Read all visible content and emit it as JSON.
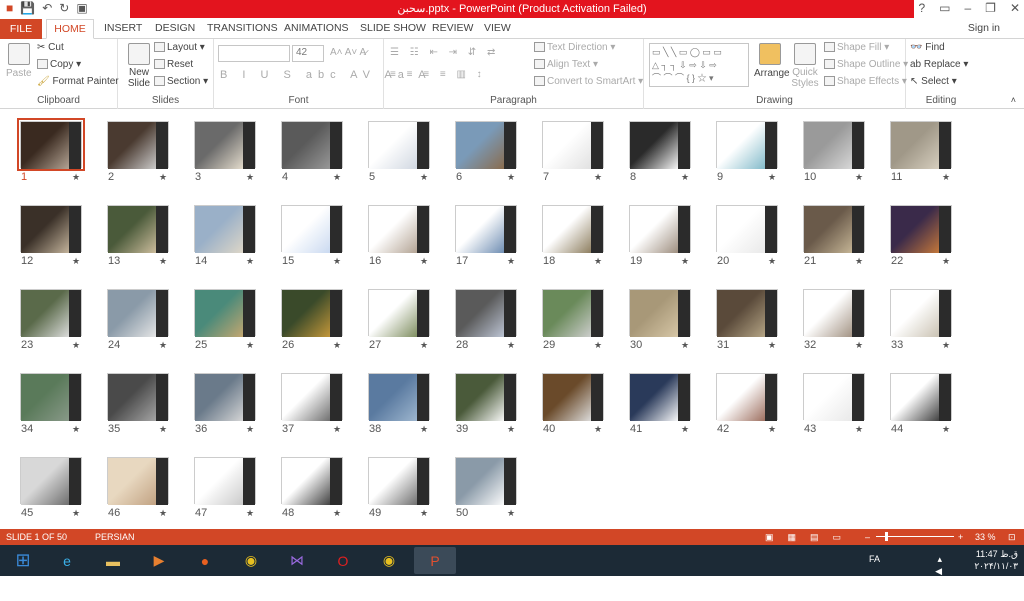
{
  "window": {
    "title": "سحبن.pptx - PowerPoint (Product Activation Failed)"
  },
  "tabs": {
    "file": "FILE",
    "home": "HOME",
    "insert": "INSERT",
    "design": "DESIGN",
    "transitions": "TRANSITIONS",
    "animations": "ANIMATIONS",
    "slideshow": "SLIDE SHOW",
    "review": "REVIEW",
    "view": "VIEW",
    "signin": "Sign in"
  },
  "ribbon": {
    "clipboard": {
      "label": "Clipboard",
      "paste": "Paste",
      "cut": "Cut",
      "copy": "Copy",
      "format_painter": "Format Painter"
    },
    "slides": {
      "label": "Slides",
      "new_slide": "New Slide",
      "layout": "Layout",
      "reset": "Reset",
      "section": "Section"
    },
    "font": {
      "label": "Font",
      "size": "42"
    },
    "paragraph": {
      "label": "Paragraph",
      "text_direction": "Text Direction",
      "align_text": "Align Text",
      "convert_smartart": "Convert to SmartArt"
    },
    "drawing": {
      "label": "Drawing",
      "arrange": "Arrange",
      "quick_styles": "Quick Styles",
      "shape_fill": "Shape Fill",
      "shape_outline": "Shape Outline",
      "shape_effects": "Shape Effects"
    },
    "editing": {
      "label": "Editing",
      "find": "Find",
      "replace": "Replace",
      "select": "Select"
    }
  },
  "slides": [
    {
      "n": "1",
      "colors": [
        "#3a2a20",
        "#b8a898"
      ]
    },
    {
      "n": "2",
      "colors": [
        "#4a3a30",
        "#cfcfcf"
      ]
    },
    {
      "n": "3",
      "colors": [
        "#6a6a6a",
        "#e8e0d0"
      ]
    },
    {
      "n": "4",
      "colors": [
        "#5a5a5a",
        "#9a9a9a"
      ]
    },
    {
      "n": "5",
      "colors": [
        "#ffffff",
        "#cfd6e0"
      ]
    },
    {
      "n": "6",
      "colors": [
        "#7a9ab8",
        "#8a6a4a"
      ]
    },
    {
      "n": "7",
      "colors": [
        "#ffffff",
        "#e0e0e0"
      ]
    },
    {
      "n": "8",
      "colors": [
        "#2a2a2a",
        "#ffffff"
      ]
    },
    {
      "n": "9",
      "colors": [
        "#ffffff",
        "#7fb8c8"
      ]
    },
    {
      "n": "10",
      "colors": [
        "#9a9a9a",
        "#dadada"
      ]
    },
    {
      "n": "11",
      "colors": [
        "#a09888",
        "#d8d0c0"
      ]
    },
    {
      "n": "12",
      "colors": [
        "#3a3028",
        "#c8b8a0"
      ]
    },
    {
      "n": "13",
      "colors": [
        "#4a5a3a",
        "#d0c0a0"
      ]
    },
    {
      "n": "14",
      "colors": [
        "#9ab0c8",
        "#e0d8c8"
      ]
    },
    {
      "n": "15",
      "colors": [
        "#ffffff",
        "#c8d8f0"
      ]
    },
    {
      "n": "16",
      "colors": [
        "#ffffff",
        "#b0a090"
      ]
    },
    {
      "n": "17",
      "colors": [
        "#ffffff",
        "#6a8ab0"
      ]
    },
    {
      "n": "18",
      "colors": [
        "#ffffff",
        "#8a7a5a"
      ]
    },
    {
      "n": "19",
      "colors": [
        "#ffffff",
        "#9a8a7a"
      ]
    },
    {
      "n": "20",
      "colors": [
        "#ffffff",
        "#e8e8e8"
      ]
    },
    {
      "n": "21",
      "colors": [
        "#6a5a4a",
        "#c8b898"
      ]
    },
    {
      "n": "22",
      "colors": [
        "#3a2a4a",
        "#c87a3a"
      ]
    },
    {
      "n": "23",
      "colors": [
        "#5a6a4a",
        "#e0e0e0"
      ]
    },
    {
      "n": "24",
      "colors": [
        "#8a9aa8",
        "#e8e8e8"
      ]
    },
    {
      "n": "25",
      "colors": [
        "#4a8a7a",
        "#c8a870"
      ]
    },
    {
      "n": "26",
      "colors": [
        "#3a4a2a",
        "#c89a3a"
      ]
    },
    {
      "n": "27",
      "colors": [
        "#ffffff",
        "#7a8a5a"
      ]
    },
    {
      "n": "28",
      "colors": [
        "#5a5a5a",
        "#c0c8d8"
      ]
    },
    {
      "n": "29",
      "colors": [
        "#6a8a5a",
        "#d0d0d0"
      ]
    },
    {
      "n": "30",
      "colors": [
        "#a89878",
        "#d8c8a8"
      ]
    },
    {
      "n": "31",
      "colors": [
        "#5a4a3a",
        "#b8a888"
      ]
    },
    {
      "n": "32",
      "colors": [
        "#ffffff",
        "#a09080"
      ]
    },
    {
      "n": "33",
      "colors": [
        "#ffffff",
        "#c8c0b0"
      ]
    },
    {
      "n": "34",
      "colors": [
        "#5a7a5a",
        "#8a9a8a"
      ]
    },
    {
      "n": "35",
      "colors": [
        "#4a4a4a",
        "#a8a8a8"
      ]
    },
    {
      "n": "36",
      "colors": [
        "#6a7a8a",
        "#d8d8d8"
      ]
    },
    {
      "n": "37",
      "colors": [
        "#ffffff",
        "#6a6a6a"
      ]
    },
    {
      "n": "38",
      "colors": [
        "#5a7aa0",
        "#a0b8d0"
      ]
    },
    {
      "n": "39",
      "colors": [
        "#4a5a3a",
        "#ffffff"
      ]
    },
    {
      "n": "40",
      "colors": [
        "#6a4a2a",
        "#e0e0e0"
      ]
    },
    {
      "n": "41",
      "colors": [
        "#2a3a5a",
        "#ffffff"
      ]
    },
    {
      "n": "42",
      "colors": [
        "#ffffff",
        "#9a6a5a"
      ]
    },
    {
      "n": "43",
      "colors": [
        "#ffffff",
        "#e8e8e8"
      ]
    },
    {
      "n": "44",
      "colors": [
        "#ffffff",
        "#3a3a3a"
      ]
    },
    {
      "n": "45",
      "colors": [
        "#d8d8d8",
        "#6a6a6a"
      ]
    },
    {
      "n": "46",
      "colors": [
        "#e8d8c0",
        "#c0a080"
      ]
    },
    {
      "n": "47",
      "colors": [
        "#ffffff",
        "#c8c8c8"
      ]
    },
    {
      "n": "48",
      "colors": [
        "#ffffff",
        "#3a3a3a"
      ]
    },
    {
      "n": "49",
      "colors": [
        "#ffffff",
        "#6a6a6a"
      ]
    },
    {
      "n": "50",
      "colors": [
        "#8a9aa8",
        "#ffffff"
      ]
    }
  ],
  "status": {
    "slide": "SLIDE 1 OF 50",
    "language": "PERSIAN",
    "zoom": "33 %"
  },
  "taskbar": {
    "lang": "FA",
    "time": "11:47 ق.ظ",
    "date": "۲۰۲۴/۱۱/۰۳"
  }
}
